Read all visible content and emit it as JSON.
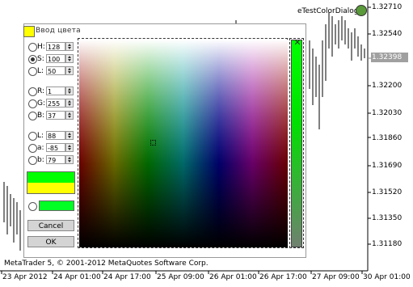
{
  "window": {
    "title": "eTestColorDialog"
  },
  "price_axis": [
    "1.32710",
    "1.32540",
    "1.32398",
    "1.32200",
    "1.32030",
    "1.31860",
    "1.31690",
    "1.31520",
    "1.31350",
    "1.31180"
  ],
  "current_price": "1.32398",
  "date_axis": [
    "23 Apr 2012",
    "24 Apr 01:00",
    "24 Apr 17:00",
    "25 Apr 09:00",
    "26 Apr 01:00",
    "26 Apr 17:00",
    "27 Apr 09:00",
    "30 Apr 01:00"
  ],
  "footer": "MetaTrader 5, © 2001-2012 MetaQuotes Software Corp.",
  "dialog": {
    "title": "Ввод цвета",
    "hsl": [
      {
        "label": "H:",
        "value": "128"
      },
      {
        "label": "S:",
        "value": "100"
      },
      {
        "label": "L:",
        "value": "50"
      }
    ],
    "rgb": [
      {
        "label": "R:",
        "value": "1"
      },
      {
        "label": "G:",
        "value": "255"
      },
      {
        "label": "B:",
        "value": "37"
      }
    ],
    "lab": [
      {
        "label": "L:",
        "value": "88"
      },
      {
        "label": "a:",
        "value": "-85"
      },
      {
        "label": "b:",
        "value": "79"
      }
    ],
    "cancel_label": "Cancel",
    "ok_label": "OK",
    "colors": {
      "new": "#00ff00",
      "old": "#ffff00",
      "selected": "#01ff25"
    }
  }
}
